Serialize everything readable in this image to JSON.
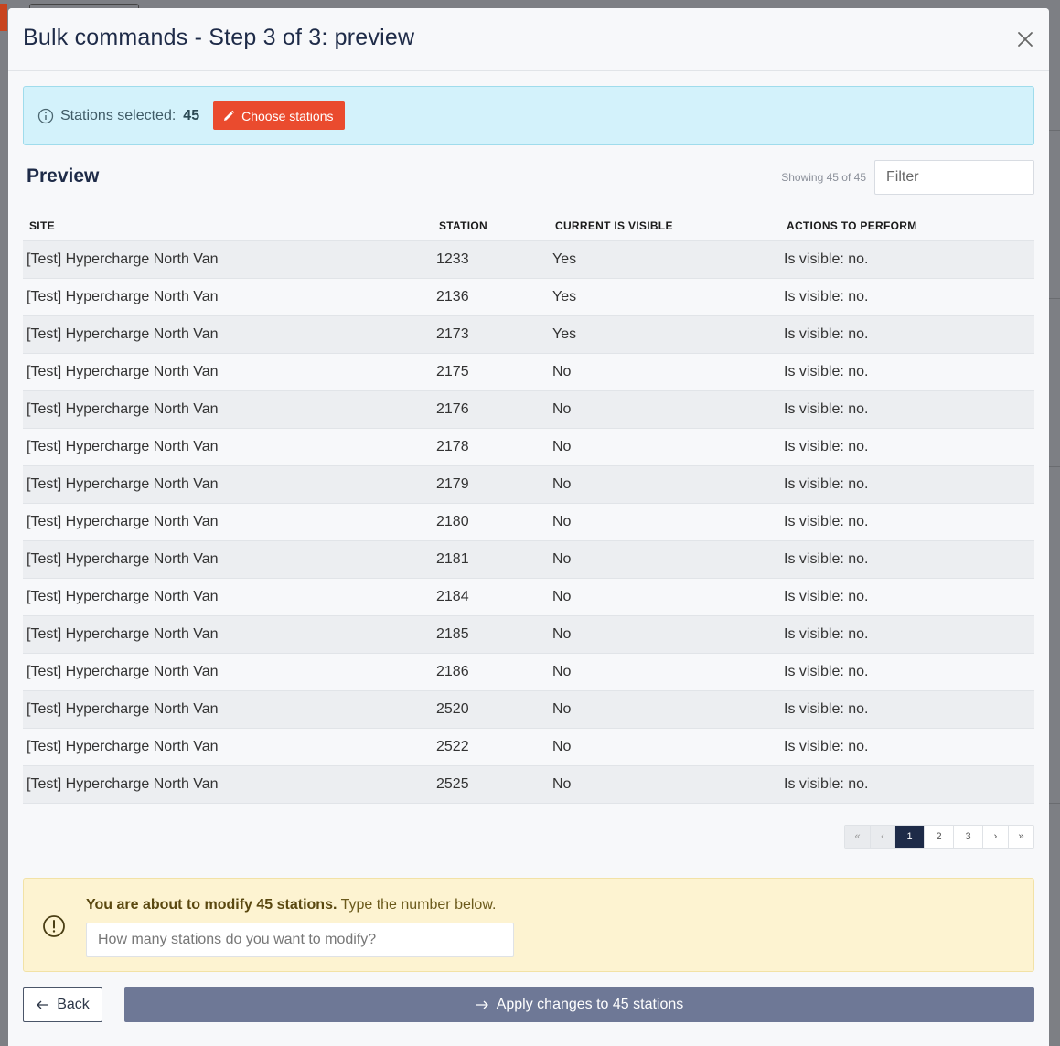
{
  "modal": {
    "title": "Bulk commands - Step 3 of 3: preview"
  },
  "selection": {
    "label": "Stations selected:",
    "count": "45",
    "choose_button": "Choose stations"
  },
  "preview": {
    "title": "Preview",
    "showing": "Showing 45 of 45",
    "filter_placeholder": "Filter"
  },
  "table": {
    "columns": [
      "SITE",
      "STATION",
      "CURRENT IS VISIBLE",
      "ACTIONS TO PERFORM"
    ],
    "rows": [
      [
        "[Test] Hypercharge North Van",
        "1233",
        "Yes",
        "Is visible: no."
      ],
      [
        "[Test] Hypercharge North Van",
        "2136",
        "Yes",
        "Is visible: no."
      ],
      [
        "[Test] Hypercharge North Van",
        "2173",
        "Yes",
        "Is visible: no."
      ],
      [
        "[Test] Hypercharge North Van",
        "2175",
        "No",
        "Is visible: no."
      ],
      [
        "[Test] Hypercharge North Van",
        "2176",
        "No",
        "Is visible: no."
      ],
      [
        "[Test] Hypercharge North Van",
        "2178",
        "No",
        "Is visible: no."
      ],
      [
        "[Test] Hypercharge North Van",
        "2179",
        "No",
        "Is visible: no."
      ],
      [
        "[Test] Hypercharge North Van",
        "2180",
        "No",
        "Is visible: no."
      ],
      [
        "[Test] Hypercharge North Van",
        "2181",
        "No",
        "Is visible: no."
      ],
      [
        "[Test] Hypercharge North Van",
        "2184",
        "No",
        "Is visible: no."
      ],
      [
        "[Test] Hypercharge North Van",
        "2185",
        "No",
        "Is visible: no."
      ],
      [
        "[Test] Hypercharge North Van",
        "2186",
        "No",
        "Is visible: no."
      ],
      [
        "[Test] Hypercharge North Van",
        "2520",
        "No",
        "Is visible: no."
      ],
      [
        "[Test] Hypercharge North Van",
        "2522",
        "No",
        "Is visible: no."
      ],
      [
        "[Test] Hypercharge North Van",
        "2525",
        "No",
        "Is visible: no."
      ]
    ]
  },
  "pagination": {
    "first": "«",
    "prev": "‹",
    "pages": [
      "1",
      "2",
      "3"
    ],
    "current": "1",
    "next": "›",
    "last": "»"
  },
  "warning": {
    "bold": "You are about to modify 45 stations.",
    "rest": " Type the number below.",
    "input_placeholder": "How many stations do you want to modify?"
  },
  "footer": {
    "back_label": "Back",
    "apply_label": "Apply changes to 45 stations"
  },
  "icons": {
    "close": "close-icon",
    "info": "info-circle-icon",
    "pencil": "pencil-icon",
    "warning": "exclamation-circle-icon",
    "back": "arrow-left-icon",
    "apply": "arrow-right-icon"
  },
  "colors": {
    "accent": "#ea4b2e",
    "info_bg": "#d3f2fb",
    "warning_bg": "#fdf3d1",
    "primary": "#1e2b48",
    "apply_bg": "#6e7896"
  }
}
